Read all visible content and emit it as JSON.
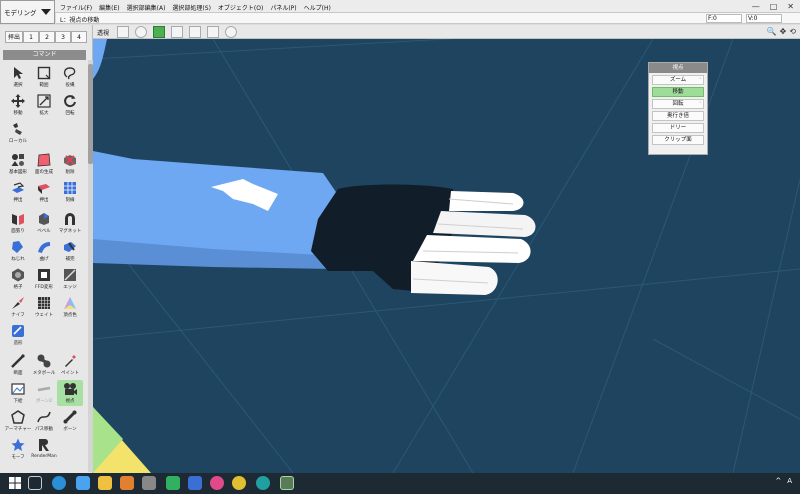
{
  "app": {
    "mode": "モデリング",
    "menu": [
      "ファイル(F)",
      "編集(E)",
      "選択部編集(A)",
      "選択部処理(S)",
      "オブジェクト(O)",
      "パネル(P)",
      "ヘルプ(H)"
    ],
    "window_controls": [
      "—",
      "□",
      "✕"
    ]
  },
  "status": {
    "text": "L：視点の移動",
    "f_value": "F:0",
    "v_value": "V:0"
  },
  "history": {
    "label": "拝出",
    "items": [
      "1",
      "2",
      "3",
      "4"
    ]
  },
  "commands": {
    "header": "コマンド",
    "tools": [
      {
        "label": "選択",
        "icon": "cursor-icon"
      },
      {
        "label": "範囲",
        "icon": "rect-select-icon"
      },
      {
        "label": "投縄",
        "icon": "lasso-icon"
      },
      {
        "label": "移動",
        "icon": "move-icon"
      },
      {
        "label": "拡大",
        "icon": "scale-icon"
      },
      {
        "label": "回転",
        "icon": "rotate-icon"
      },
      {
        "label": "ローカル",
        "icon": "local-icon"
      },
      {
        "label": "基本図形",
        "icon": "primitive-icon"
      },
      {
        "label": "面の生成",
        "icon": "face-create-icon"
      },
      {
        "label": "削除",
        "icon": "delete-icon"
      },
      {
        "label": "押出",
        "icon": "extrude-icon"
      },
      {
        "label": "押出",
        "icon": "push-icon"
      },
      {
        "label": "刻線",
        "icon": "knife-grid-icon"
      },
      {
        "label": "面張り",
        "icon": "face-fill-icon"
      },
      {
        "label": "ベベル",
        "icon": "bevel-icon"
      },
      {
        "label": "マグネット",
        "icon": "magnet-icon"
      },
      {
        "label": "ねじれ",
        "icon": "twist-icon"
      },
      {
        "label": "曲げ",
        "icon": "bend-icon"
      },
      {
        "label": "補完",
        "icon": "smooth-icon"
      },
      {
        "label": "格子",
        "icon": "lattice-icon"
      },
      {
        "label": "FFD変形",
        "icon": "ffd-icon"
      },
      {
        "label": "エッジ",
        "icon": "edge-icon"
      },
      {
        "label": "ナイフ",
        "icon": "knife-icon"
      },
      {
        "label": "ウェイト",
        "icon": "weight-icon"
      },
      {
        "label": "頂点色",
        "icon": "vertex-color-icon"
      },
      {
        "label": "造形",
        "icon": "sculpt-icon"
      },
      {
        "label": "断面",
        "icon": "section-icon"
      },
      {
        "label": "メタボール",
        "icon": "metaball-icon"
      },
      {
        "label": "ペイント",
        "icon": "paint-icon"
      },
      {
        "label": "下絵",
        "icon": "underlay-icon"
      },
      {
        "label": "ボーン2",
        "icon": "bone-gray-icon"
      },
      {
        "label": "視点",
        "icon": "camera-icon"
      },
      {
        "label": "アーマチャー",
        "icon": "armature-icon"
      },
      {
        "label": "パス移動",
        "icon": "path-icon"
      },
      {
        "label": "ボーン",
        "icon": "bone-icon"
      },
      {
        "label": "モーフ",
        "icon": "morph-icon"
      },
      {
        "label": "RenderMan",
        "icon": "renderman-icon"
      }
    ]
  },
  "viewport": {
    "view_label": "透視",
    "nav_icons": [
      "🔍",
      "✥",
      "⟲"
    ]
  },
  "view_palette": {
    "title": "視点",
    "items": [
      {
        "label": "ズーム",
        "selected": false,
        "has_sub": true
      },
      {
        "label": "移動",
        "selected": true,
        "has_sub": false
      },
      {
        "label": "回転",
        "selected": false,
        "has_sub": true
      },
      {
        "label": "奥行き倍",
        "selected": false,
        "has_sub": false
      },
      {
        "label": "ドリー",
        "selected": false,
        "has_sub": false
      },
      {
        "label": "クリップ面",
        "selected": false,
        "has_sub": false
      }
    ]
  },
  "colors": {
    "scene_bg": "#1e4460",
    "skin": "#6fa8f2",
    "glove": "#111d28",
    "selected": "#9fdc9a"
  },
  "taskbar": {
    "tray": [
      "^",
      "A"
    ]
  }
}
